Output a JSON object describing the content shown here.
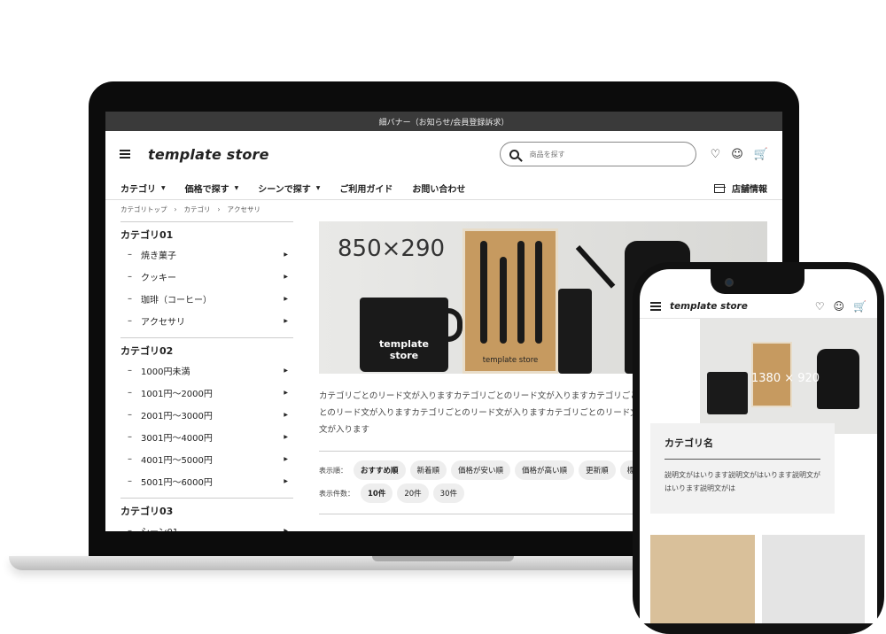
{
  "banner": "細バナー（お知らせ/会員登録訴求）",
  "logo": "template store",
  "search_placeholder": "商品を探す",
  "nav": {
    "items": [
      "カテゴリ",
      "価格で探す",
      "シーンで探す",
      "ご利用ガイド",
      "お問い合わせ"
    ],
    "store_info": "店舗情報"
  },
  "breadcrumb": [
    "カテゴリトップ",
    "カテゴリ",
    "アクセサリ"
  ],
  "sidebar": {
    "cat1": {
      "title": "カテゴリ01",
      "items": [
        "焼き菓子",
        "クッキー",
        "珈琲（コーヒー）",
        "アクセサリ"
      ]
    },
    "cat2": {
      "title": "カテゴリ02",
      "items": [
        "1000円未満",
        "1001円～2000円",
        "2001円～3000円",
        "3001円～4000円",
        "4001円～5000円",
        "5001円～6000円"
      ]
    },
    "cat3": {
      "title": "カテゴリ03",
      "items": [
        "シーン01"
      ]
    }
  },
  "hero": {
    "size_label": "850×290",
    "mug_text_1": "template",
    "mug_text_2": "store",
    "box_text": "template store"
  },
  "lead": "カテゴリごとのリード文が入りますカテゴリごとのリード文が入りますカテゴリごとのリード文が入りますカテゴリごとのリード文が入りますカテゴリごとのリード文が入りますカテゴリごとのリード文が入りますカテゴリごとのリード文が入ります",
  "sort": {
    "label": "表示順：",
    "options": [
      "おすすめ順",
      "新着順",
      "価格が安い順",
      "価格が高い順",
      "更新順",
      "標準"
    ]
  },
  "count": {
    "label": "表示件数：",
    "options": [
      "10件",
      "20件",
      "30件"
    ]
  },
  "phone": {
    "logo": "template store",
    "hero_size": "1380 × 920",
    "card_title": "カテゴリ名",
    "card_desc": "説明文がはいります説明文がはいります説明文がはいります説明文がは"
  }
}
